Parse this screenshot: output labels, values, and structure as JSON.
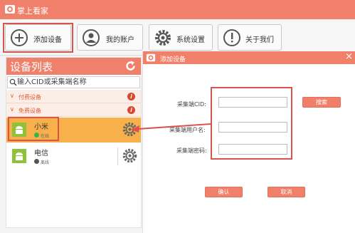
{
  "app": {
    "title": "掌上看家"
  },
  "toolbar": {
    "add_device": "添加设备",
    "my_account": "我的账户",
    "system_settings": "系统设置",
    "about_us": "关于我们"
  },
  "device_panel": {
    "title": "设备列表",
    "search_placeholder": "输入CID或采集端名称",
    "groups": [
      {
        "label": "付费设备"
      },
      {
        "label": "免费设备"
      }
    ],
    "devices": [
      {
        "name": "小米",
        "status": "在线",
        "status_color": "#39b54a"
      },
      {
        "name": "电信",
        "status": "离线",
        "status_color": "#555555"
      }
    ]
  },
  "dialog": {
    "title": "添加设备",
    "close_symbol": "×",
    "fields": {
      "cid_label": "采集端CID:",
      "username_label": "采集端用户名:",
      "password_label": "采集端密码:"
    },
    "search_button": "搜索",
    "confirm_button": "确认",
    "cancel_button": "取消"
  },
  "colors": {
    "accent": "#f0806a",
    "selected_row": "#f7b04a",
    "annotation": "#d9534f"
  }
}
